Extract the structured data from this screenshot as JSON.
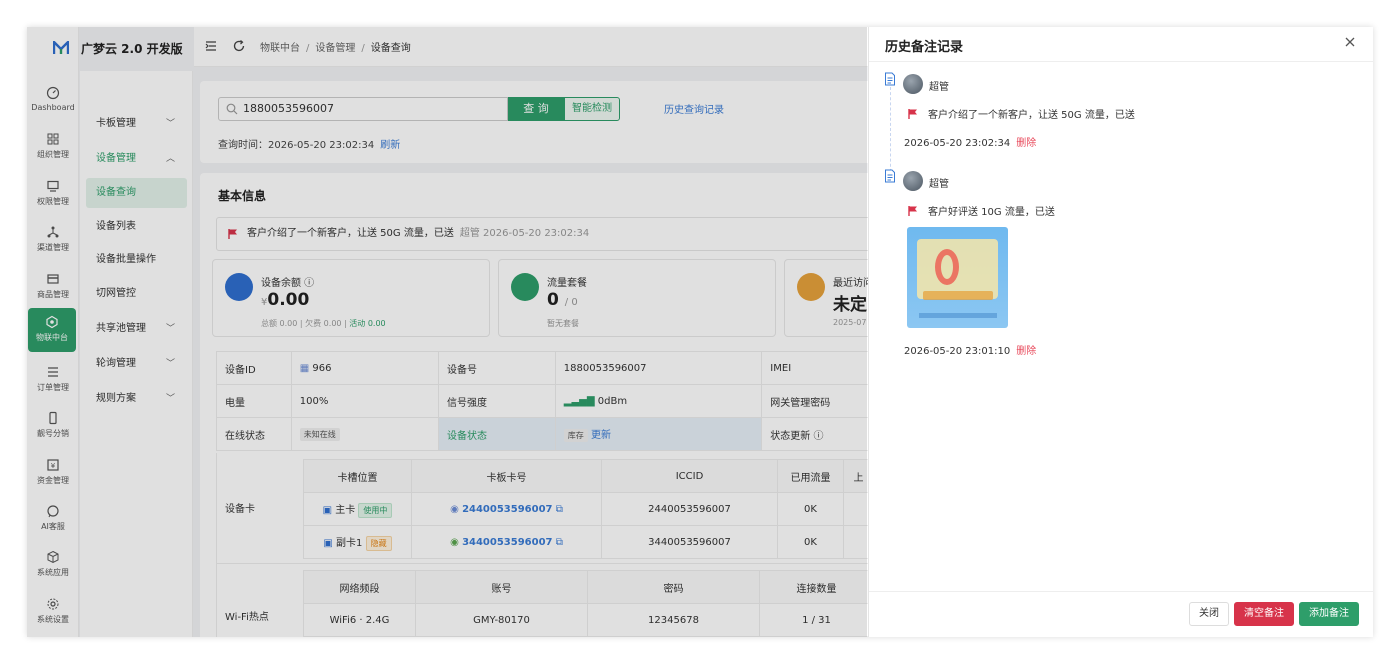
{
  "app": {
    "title": "广梦云 2.0 开发版",
    "accent": "#2e9e6a"
  },
  "rail": {
    "items": [
      {
        "label": "Dashboard",
        "icon": "dashboard-icon"
      },
      {
        "label": "组织管理",
        "icon": "grid-icon"
      },
      {
        "label": "权限管理",
        "icon": "monitor-icon"
      },
      {
        "label": "渠道管理",
        "icon": "network-icon"
      },
      {
        "label": "商品管理",
        "icon": "store-icon"
      },
      {
        "label": "物联中台",
        "icon": "iot-icon",
        "active": true
      },
      {
        "label": "订单管理",
        "icon": "list-icon"
      },
      {
        "label": "靓号分销",
        "icon": "phone-icon"
      },
      {
        "label": "资金管理",
        "icon": "yen-icon"
      },
      {
        "label": "AI客服",
        "icon": "chat-icon"
      },
      {
        "label": "系统应用",
        "icon": "cube-icon"
      },
      {
        "label": "系统设置",
        "icon": "gear-icon"
      }
    ]
  },
  "submenu": {
    "items": [
      {
        "label": "卡板管理",
        "chevron": "﹀"
      },
      {
        "label": "设备管理",
        "chevron": "︿",
        "open": true
      },
      {
        "label": "设备查询",
        "current": true
      },
      {
        "label": "设备列表"
      },
      {
        "label": "设备批量操作"
      },
      {
        "label": "切网管控"
      },
      {
        "label": "共享池管理",
        "chevron": "﹀"
      },
      {
        "label": "轮询管理",
        "chevron": "﹀"
      },
      {
        "label": "规则方案",
        "chevron": "﹀"
      }
    ]
  },
  "breadcrumb": [
    "物联中台",
    "设备管理",
    "设备查询"
  ],
  "search": {
    "value": "1880053596007",
    "query_label": "查 询",
    "smart_label": "智能检测",
    "history_link": "历史查询记录",
    "time_label": "查询时间：2026-05-20 23:02:34",
    "refresh_label": "刷新"
  },
  "basic": {
    "title": "基本信息",
    "latest_note": "客户介绍了一个新客户，让送 50G 流量，已送",
    "latest_note_meta": "超管   2026-05-20 23:02:34",
    "stats": [
      {
        "label": "设备余额",
        "value": "0.00",
        "prefix": "¥",
        "sub1": "总额 0.00",
        "sub2": "欠费 0.00",
        "sub3": "活动 0.00",
        "color": "#2f6fd0"
      },
      {
        "label": "流量套餐",
        "value": "0",
        "suffix": "/ 0",
        "sub1": "暂无套餐",
        "color": "#2e9e6a"
      },
      {
        "label": "最近访问",
        "value": "未定",
        "sub1": "2025-07",
        "color": "#e6a23c"
      }
    ]
  },
  "info_table": {
    "row1": {
      "k1": "设备ID",
      "v1": "966",
      "k2": "设备号",
      "v2": "1880053596007",
      "k3": "IMEI"
    },
    "row2": {
      "k1": "电量",
      "v1": "100%",
      "k2": "信号强度",
      "v2": "0dBm",
      "k3": "网关管理密码"
    },
    "row3": {
      "k1": "在线状态",
      "v1": "未知在线",
      "k2": "设备状态",
      "v2_tag": "库存",
      "v2_link": "更新",
      "k3": "状态更新"
    },
    "card_label": "设备卡",
    "card_headers": [
      "卡槽位置",
      "卡板卡号",
      "ICCID",
      "已用流量",
      "上"
    ],
    "cards": [
      {
        "slot": "主卡",
        "badge": "使用中",
        "number": "2440053596007",
        "iccid": "2440053596007",
        "used": "0K"
      },
      {
        "slot": "副卡1",
        "badge": "隐藏",
        "number": "3440053596007",
        "iccid": "3440053596007",
        "used": "0K"
      }
    ],
    "wifi_label": "Wi-Fi热点",
    "wifi_headers": [
      "网络频段",
      "账号",
      "密码",
      "连接数量"
    ],
    "wifi": [
      {
        "band": "WiFi6 · 2.4G",
        "account": "GMY-80170",
        "password": "12345678",
        "count": "1 / 31"
      }
    ]
  },
  "drawer": {
    "title": "历史备注记录",
    "notes": [
      {
        "author": "超管",
        "text": "客户介绍了一个新客户，让送 50G 流量，已送",
        "time": "2026-05-20 23:02:34",
        "delete": "删除"
      },
      {
        "author": "超管",
        "text": "客户好评送 10G 流量，已送",
        "time": "2026-05-20 23:01:10",
        "delete": "删除"
      }
    ],
    "close_label": "关闭",
    "clear_label": "清空备注",
    "add_label": "添加备注"
  }
}
